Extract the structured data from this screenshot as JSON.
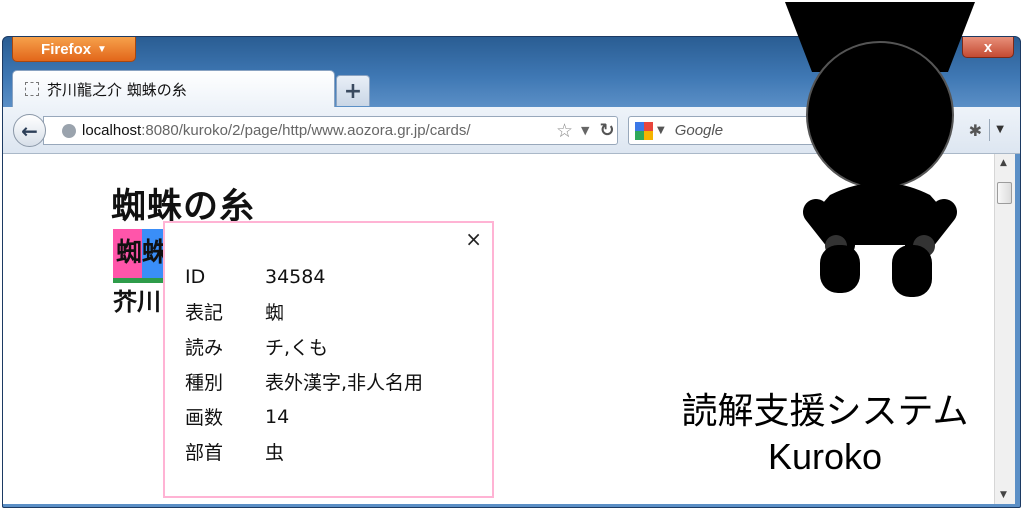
{
  "browser": {
    "menu_button": "Firefox",
    "tab_title": "芥川龍之介 蜘蛛の糸",
    "new_tab_label": "+",
    "url_host": "localhost",
    "url_rest": ":8080/kuroko/2/page/http/www.aozora.gr.jp/cards/",
    "search_placeholder": "Google",
    "close_label": "x"
  },
  "page": {
    "title": "蜘蛛の糸",
    "highlighted_word": "蜘蛛",
    "author": "芥川"
  },
  "popup": {
    "close_label": "×",
    "rows": [
      {
        "key": "ID",
        "value": "34584"
      },
      {
        "key": "表記",
        "value": "蜘"
      },
      {
        "key": "読み",
        "value": "チ,くも"
      },
      {
        "key": "種別",
        "value": "表外漢字,非人名用"
      },
      {
        "key": "画数",
        "value": "14"
      },
      {
        "key": "部首",
        "value": "虫"
      }
    ]
  },
  "overlay": {
    "caption_line1": "読解支援システム",
    "caption_line2": "Kuroko"
  },
  "colors": {
    "highlight_pink": "#ff55aa",
    "highlight_blue": "#3a8ef8",
    "underline_green": "#2e9c4a",
    "popup_border": "#ffb3d4",
    "firefox_orange": "#e2661a"
  },
  "icons": [
    "back-arrow-icon",
    "globe-icon",
    "star-icon",
    "reload-icon",
    "google-icon",
    "addon-icon",
    "close-icon",
    "kuroko-mascot-icon"
  ]
}
